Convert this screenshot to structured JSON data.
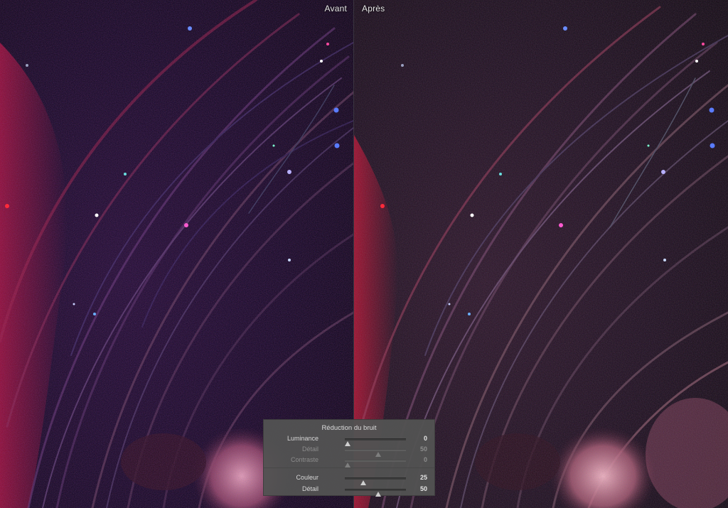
{
  "view": {
    "before_label": "Avant",
    "after_label": "Après"
  },
  "noise_panel": {
    "title": "Réduction du bruit",
    "luminance": [
      {
        "label": "Luminance",
        "value": "0",
        "level": 0,
        "enabled": true
      },
      {
        "label": "Détail",
        "value": "50",
        "level": 0.5,
        "enabled": false
      },
      {
        "label": "Contraste",
        "value": "0",
        "level": 0,
        "enabled": false
      }
    ],
    "color": [
      {
        "label": "Couleur",
        "value": "25",
        "level": 0.25,
        "enabled": true
      },
      {
        "label": "Détail",
        "value": "50",
        "level": 0.5,
        "enabled": true
      }
    ]
  }
}
